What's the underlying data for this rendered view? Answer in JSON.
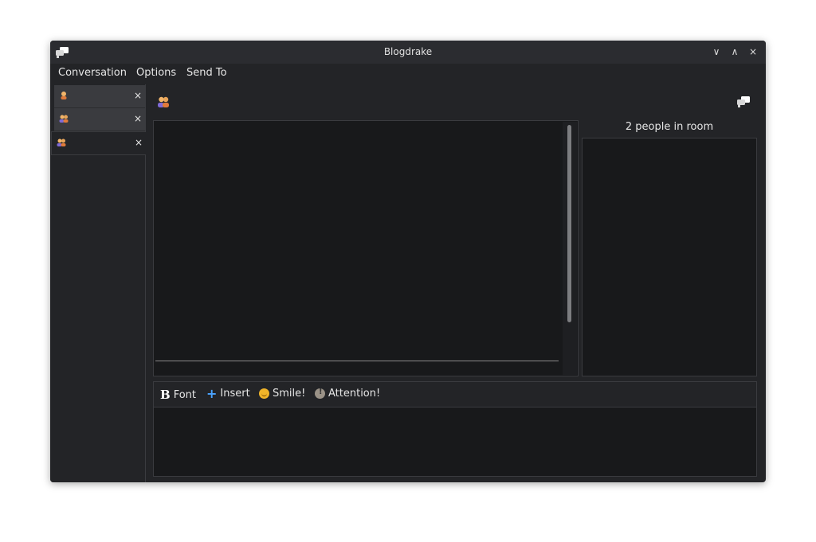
{
  "window": {
    "title": "Blogdrake"
  },
  "menu": {
    "items": [
      "Conversation",
      "Options",
      "Send To"
    ]
  },
  "tabs": [
    {
      "icon": "person-icon",
      "close": "×",
      "state": "inactive"
    },
    {
      "icon": "group-icon",
      "close": "×",
      "state": "inactive"
    },
    {
      "icon": "group-icon",
      "close": "×",
      "state": "active"
    }
  ],
  "room": {
    "people_label": "2 people in room"
  },
  "toolbar": {
    "font_label": "Font",
    "insert_label": "Insert",
    "smile_label": "Smile!",
    "attention_label": "Attention!"
  },
  "window_controls": {
    "minimize": "∨",
    "maximize": "∧",
    "close": "×"
  },
  "colors": {
    "window_bg": "#232427",
    "panel_bg": "#18191b",
    "accent": "#4aa3ff"
  }
}
